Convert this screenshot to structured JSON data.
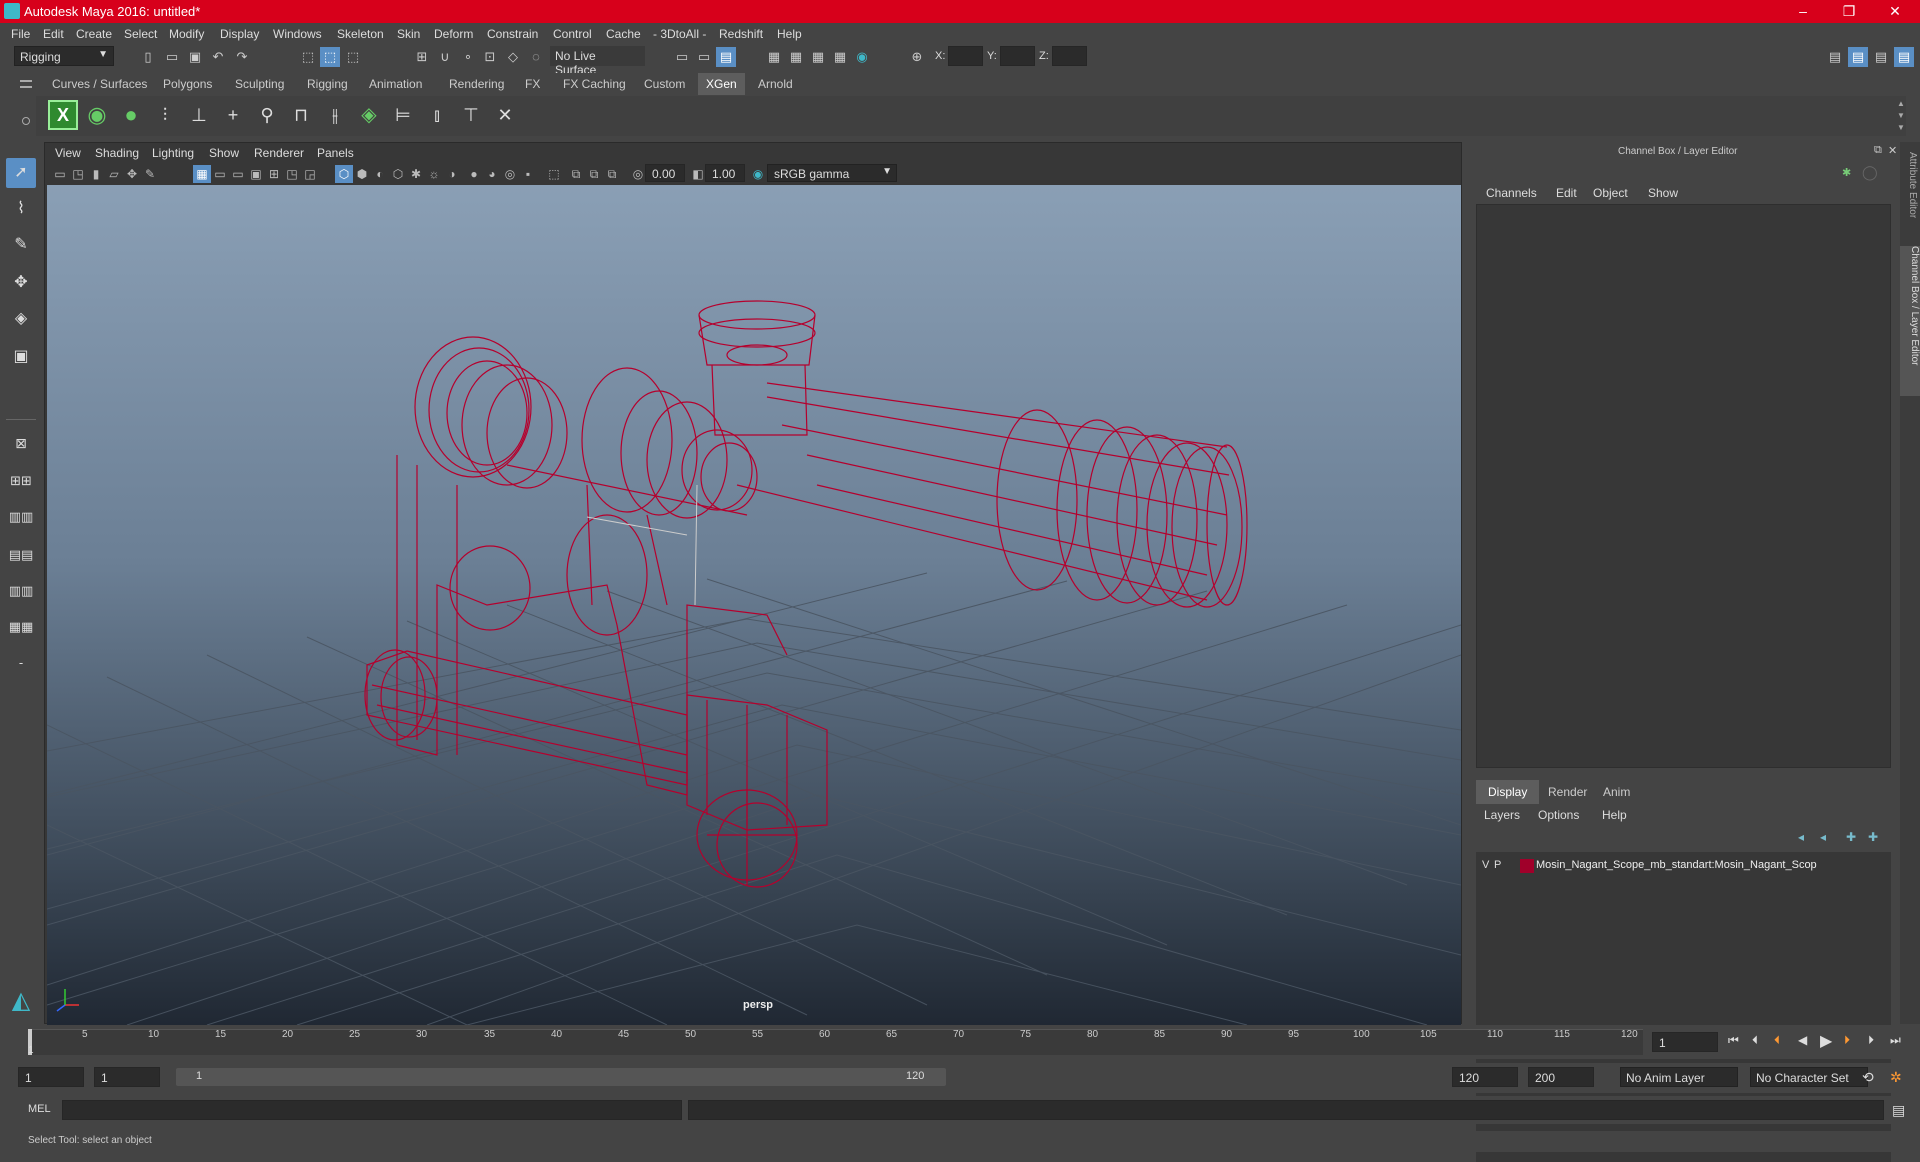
{
  "title": "Autodesk Maya 2016: untitled*",
  "window_buttons": [
    "–",
    "❐",
    "✕"
  ],
  "menu": [
    "File",
    "Edit",
    "Create",
    "Select",
    "Modify",
    "Display",
    "Windows",
    "Skeleton",
    "Skin",
    "Deform",
    "Constrain",
    "Control",
    "Cache",
    "- 3DtoAll -",
    "Redshift",
    "Help"
  ],
  "toolbar": {
    "mode": "Rigging",
    "live_surface": "No Live Surface",
    "x_label": "X:",
    "y_label": "Y:",
    "z_label": "Z:"
  },
  "shelf_tabs": [
    "Curves / Surfaces",
    "Polygons",
    "Sculpting",
    "Rigging",
    "Animation",
    "Rendering",
    "FX",
    "FX Caching",
    "Custom",
    "XGen",
    "Arnold"
  ],
  "active_shelf": "XGen",
  "viewport": {
    "menus": [
      "View",
      "Shading",
      "Lighting",
      "Show",
      "Renderer",
      "Panels"
    ],
    "exposure": "0.00",
    "gamma": "1.00",
    "colorspace": "sRGB gamma",
    "camera": "persp"
  },
  "channel_box": {
    "title": "Channel Box / Layer Editor",
    "menus": [
      "Channels",
      "Edit",
      "Object",
      "Show"
    ]
  },
  "layer_editor": {
    "tabs": [
      "Display",
      "Render",
      "Anim"
    ],
    "active_tab": "Display",
    "menus": [
      "Layers",
      "Options",
      "Help"
    ],
    "layer": {
      "v": "V",
      "p": "P",
      "color": "#a0002a",
      "name": "Mosin_Nagant_Scope_mb_standart:Mosin_Nagant_Scop"
    }
  },
  "side_tabs": [
    "Attribute Editor",
    "Channel Box / Layer Editor"
  ],
  "timeline": {
    "ticks": [
      "5",
      "10",
      "15",
      "20",
      "25",
      "30",
      "35",
      "40",
      "45",
      "50",
      "55",
      "60",
      "65",
      "70",
      "75",
      "80",
      "85",
      "90",
      "95",
      "100",
      "105",
      "110",
      "115",
      "120"
    ],
    "start_marker": "1",
    "current_frame": "1"
  },
  "range": {
    "start": "1",
    "start2": "1",
    "slider_start": "1",
    "slider_end": "120",
    "end": "120",
    "end2": "200",
    "anim_layer": "No Anim Layer",
    "character_set": "No Character Set"
  },
  "cmd": {
    "lang": "MEL"
  },
  "help": "Select Tool: select an object",
  "colors": {
    "wire": "#b5002d",
    "title": "#d7001b",
    "active_blue": "#5a8fc5"
  }
}
